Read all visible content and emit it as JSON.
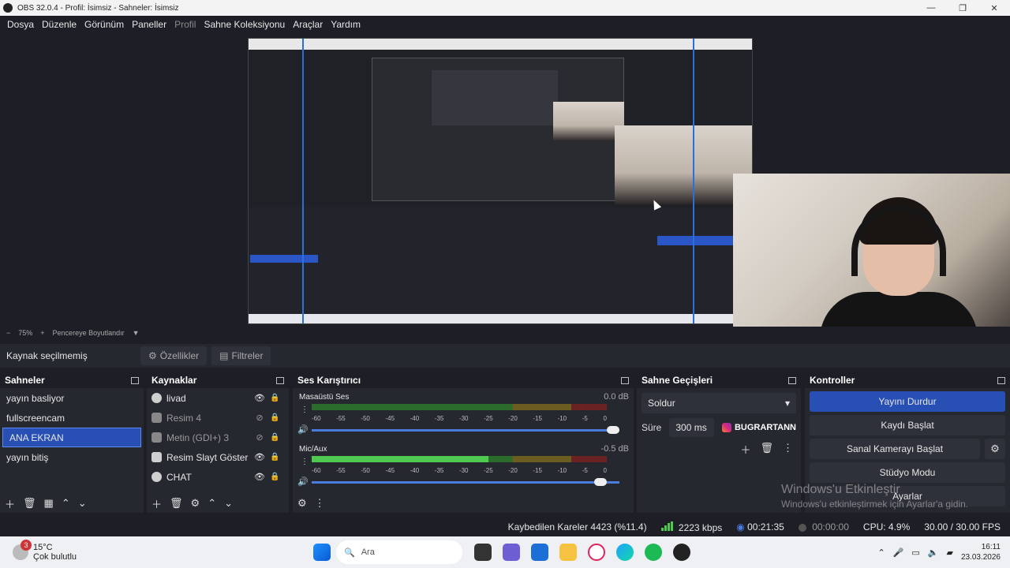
{
  "window": {
    "title": "OBS 32.0.4 - Profil: İsimsiz - Sahneler: İsimsiz",
    "minimize": "—",
    "maximize": "❐",
    "close": "✕"
  },
  "menu": [
    "Dosya",
    "Düzenle",
    "Görünüm",
    "Paneller",
    "Profil",
    "Sahne Koleksiyonu",
    "Araçlar",
    "Yardım"
  ],
  "zoom": {
    "minus": "−",
    "level": "75%",
    "plus": "+",
    "fit": "Pencereye Boyutlandır",
    "chevron": "▼"
  },
  "sourcebar": {
    "no_selection": "Kaynak seçilmemiş",
    "properties": "Özellikler",
    "filters": "Filtreler"
  },
  "scenes": {
    "title": "Sahneler",
    "items": [
      "yayın basliyor",
      "fullscreencam",
      "ANA EKRAN",
      "yayın bitiş"
    ],
    "selected_index": 2
  },
  "sources": {
    "title": "Kaynaklar",
    "items": [
      {
        "name": "livad",
        "visible": true,
        "icon": "browser-icon"
      },
      {
        "name": "Resim 4",
        "visible": false,
        "icon": "image-icon"
      },
      {
        "name": "Metin (GDI+) 3",
        "visible": false,
        "icon": "text-icon"
      },
      {
        "name": "Resim Slayt Göster",
        "visible": true,
        "icon": "slideshow-icon"
      },
      {
        "name": "CHAT",
        "visible": true,
        "icon": "browser-icon"
      }
    ]
  },
  "mixer": {
    "title": "Ses Karıştırıcı",
    "ticks": [
      "-60",
      "-55",
      "-50",
      "-45",
      "-40",
      "-35",
      "-30",
      "-25",
      "-20",
      "-15",
      "-10",
      "-5",
      "0"
    ],
    "channels": [
      {
        "name": "Masaüstü Ses",
        "db": "0.0 dB",
        "volume": 1.0,
        "level": 0
      },
      {
        "name": "Mic/Aux",
        "db": "-0.5 dB",
        "volume": 0.96,
        "level": 0.6
      }
    ]
  },
  "transitions": {
    "title": "Sahne Geçişleri",
    "selected": "Soldur",
    "duration_label": "Süre",
    "duration": "300 ms",
    "overlay_text": "BUGRARTANN"
  },
  "controls": {
    "title": "Kontroller",
    "stop_stream": "Yayını Durdur",
    "start_record": "Kaydı Başlat",
    "virtual_cam": "Sanal Kamerayı Başlat",
    "studio_mode": "Stüdyo Modu",
    "settings": "Ayarlar"
  },
  "watermark": {
    "line1": "Windows'u Etkinleştir",
    "line2": "Windows'u etkinleştirmek için Ayarlar'a gidin."
  },
  "status": {
    "dropped": "Kaybedilen Kareler 4423 (%11.4)",
    "bitrate": "2223 kbps",
    "stream_time": "00:21:35",
    "record_time": "00:00:00",
    "cpu": "CPU: 4.9%",
    "fps": "30.00 / 30.00 FPS"
  },
  "taskbar": {
    "temp": "15°C",
    "weather": "Çok bulutlu",
    "weather_badge": "3",
    "search": "Ara",
    "time": "16:11",
    "date": "23.03.2026"
  },
  "colors": {
    "accent": "#284fb4",
    "panel": "#262830",
    "background": "#1e1f26"
  }
}
